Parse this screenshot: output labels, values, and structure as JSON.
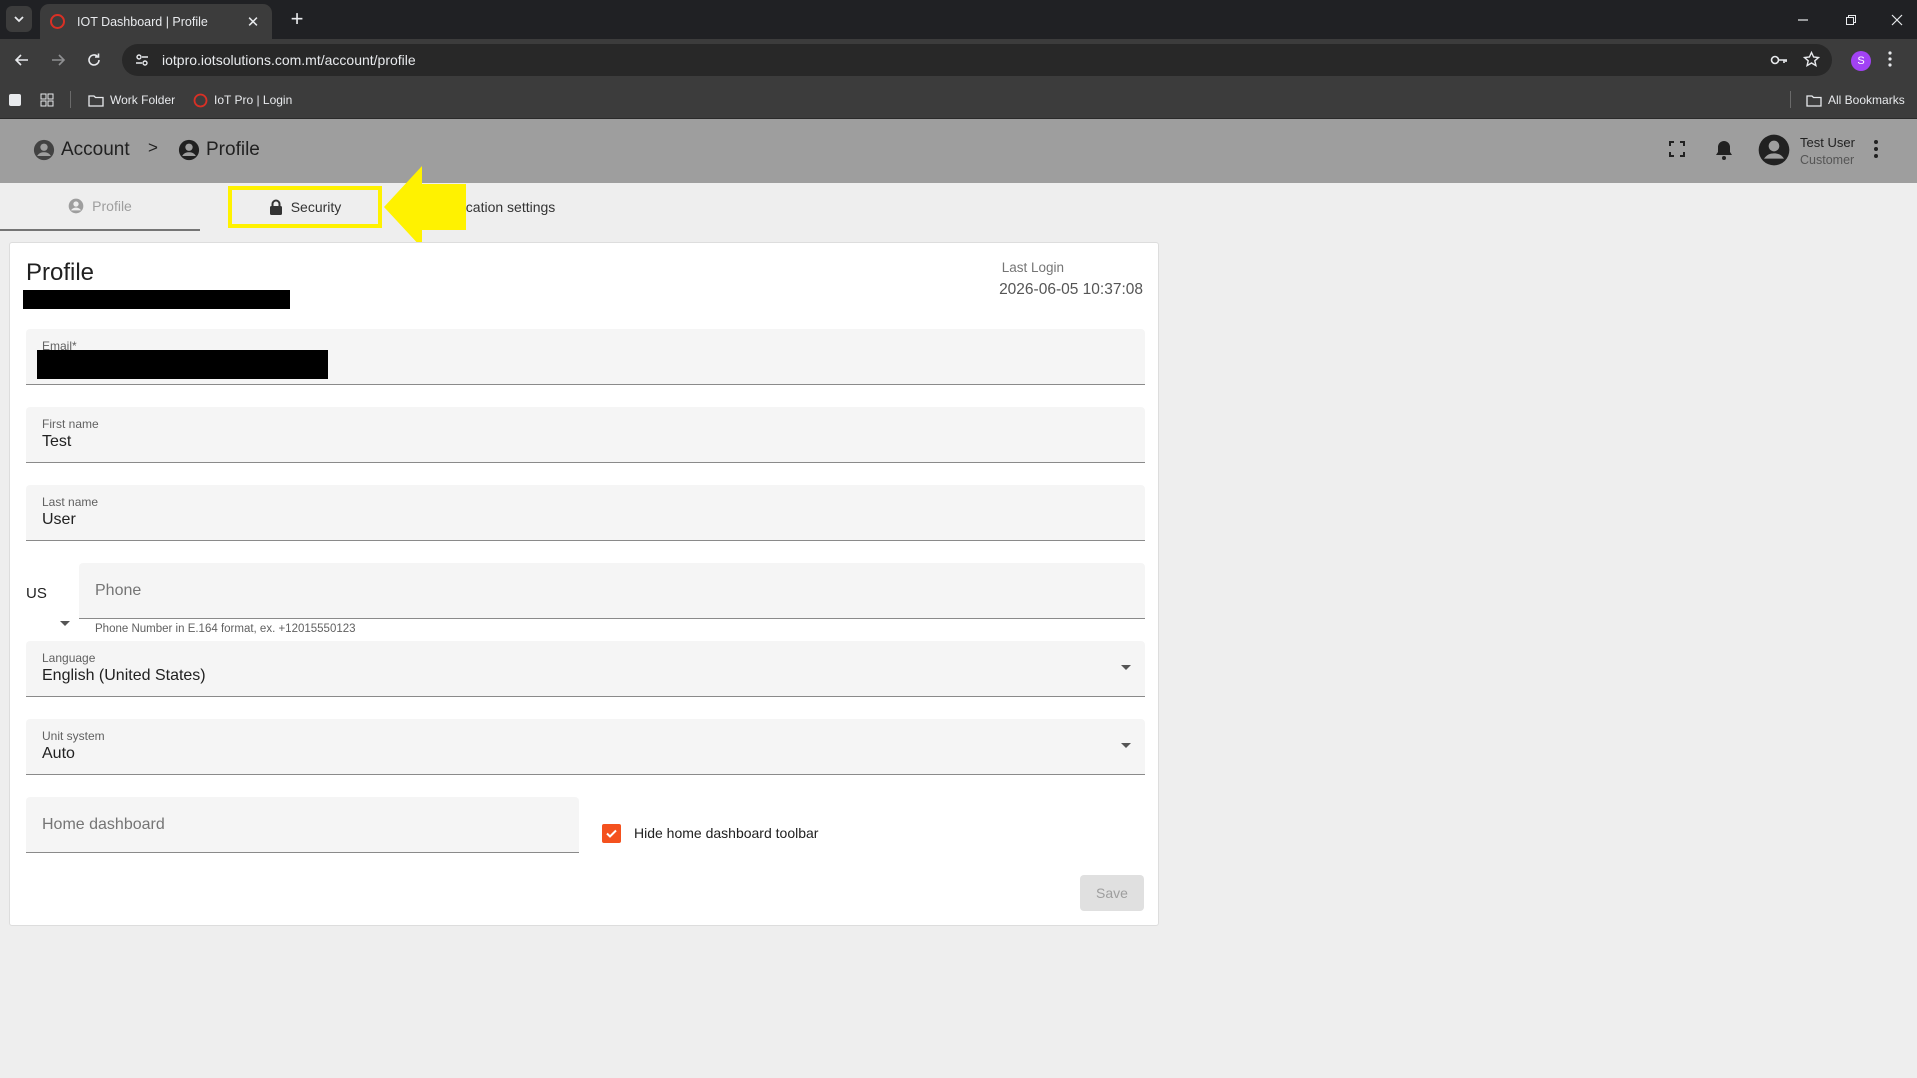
{
  "browser": {
    "tab_title": "IOT Dashboard | Profile",
    "url": "iotpro.iotsolutions.com.mt/account/profile",
    "profile_initial": "S",
    "bookmarks": [
      {
        "label": "Work Folder"
      },
      {
        "label": "IoT Pro | Login"
      }
    ],
    "all_bookmarks": "All Bookmarks"
  },
  "header": {
    "breadcrumb": [
      "Account",
      "Profile"
    ],
    "breadcrumb_sep": ">",
    "user_name": "Test User",
    "user_role": "Customer"
  },
  "tabs": [
    {
      "label": "Profile"
    },
    {
      "label": "Security"
    },
    {
      "label": "otification settings"
    }
  ],
  "profile": {
    "title": "Profile",
    "last_login_label": "Last Login",
    "last_login_value": "2026-06-05 10:37:08",
    "email_label": "Email*",
    "first_name_label": "First name",
    "first_name_value": "Test",
    "last_name_label": "Last name",
    "last_name_value": "User",
    "country_code": "US",
    "phone_placeholder": "Phone",
    "phone_hint": "Phone Number in E.164 format, ex. +12015550123",
    "language_label": "Language",
    "language_value": "English (United States)",
    "unit_label": "Unit system",
    "unit_value": "Auto",
    "home_dashboard_placeholder": "Home dashboard",
    "hide_toolbar_label": "Hide home dashboard toolbar",
    "hide_toolbar_checked": true,
    "save_label": "Save"
  },
  "colors": {
    "accent": "#f4511e",
    "highlight": "#fff200",
    "header_bg": "#9e9e9e"
  }
}
